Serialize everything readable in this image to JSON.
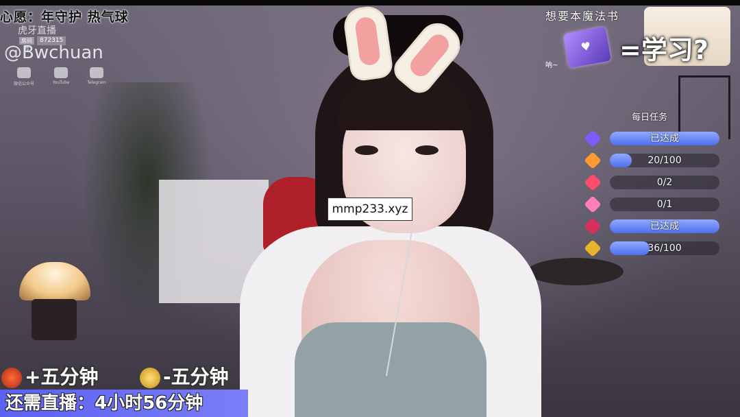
{
  "stream": {
    "wish_text": "心愿：年守护 热气球",
    "platform_logo_text": "虎牙直播",
    "room_tag": "房间号",
    "room_number": "872315",
    "handle": "@Bwchuan",
    "social": [
      {
        "icon": "wechat-icon",
        "label": "微信公众号"
      },
      {
        "icon": "youtube-icon",
        "label": "YouTube"
      },
      {
        "icon": "telegram-icon",
        "label": "Telegram"
      }
    ]
  },
  "book_panel": {
    "title": "想要本魔法书",
    "mumble": "呐~",
    "equation": "=学习?",
    "icon": "magic-book-icon"
  },
  "daily_tasks": {
    "title": "每日任务",
    "items": [
      {
        "icon": "purple-gem-icon",
        "color": "#7a5cff",
        "progress": 1.0,
        "text": "已达成"
      },
      {
        "icon": "orange-gem-icon",
        "color": "#ff9a2e",
        "progress": 0.2,
        "text": "20/100"
      },
      {
        "icon": "red-gem-icon",
        "color": "#ff4c6a",
        "progress": 0.0,
        "text": "0/2"
      },
      {
        "icon": "pink-flower-icon",
        "color": "#ff7fb8",
        "progress": 0.0,
        "text": "0/1"
      },
      {
        "icon": "rose-icon",
        "color": "#d8305a",
        "progress": 1.0,
        "text": "已达成"
      },
      {
        "icon": "trophy-icon",
        "color": "#e8b429",
        "progress": 0.36,
        "text": "36/100"
      }
    ]
  },
  "watermark": "mmp233.xyz",
  "rules": {
    "add_icon": "potion-icon",
    "add_text": "+五分钟",
    "sub_icon": "trophy-icon",
    "sub_text": "-五分钟",
    "remaining_text": "还需直播：4小时56分钟"
  }
}
